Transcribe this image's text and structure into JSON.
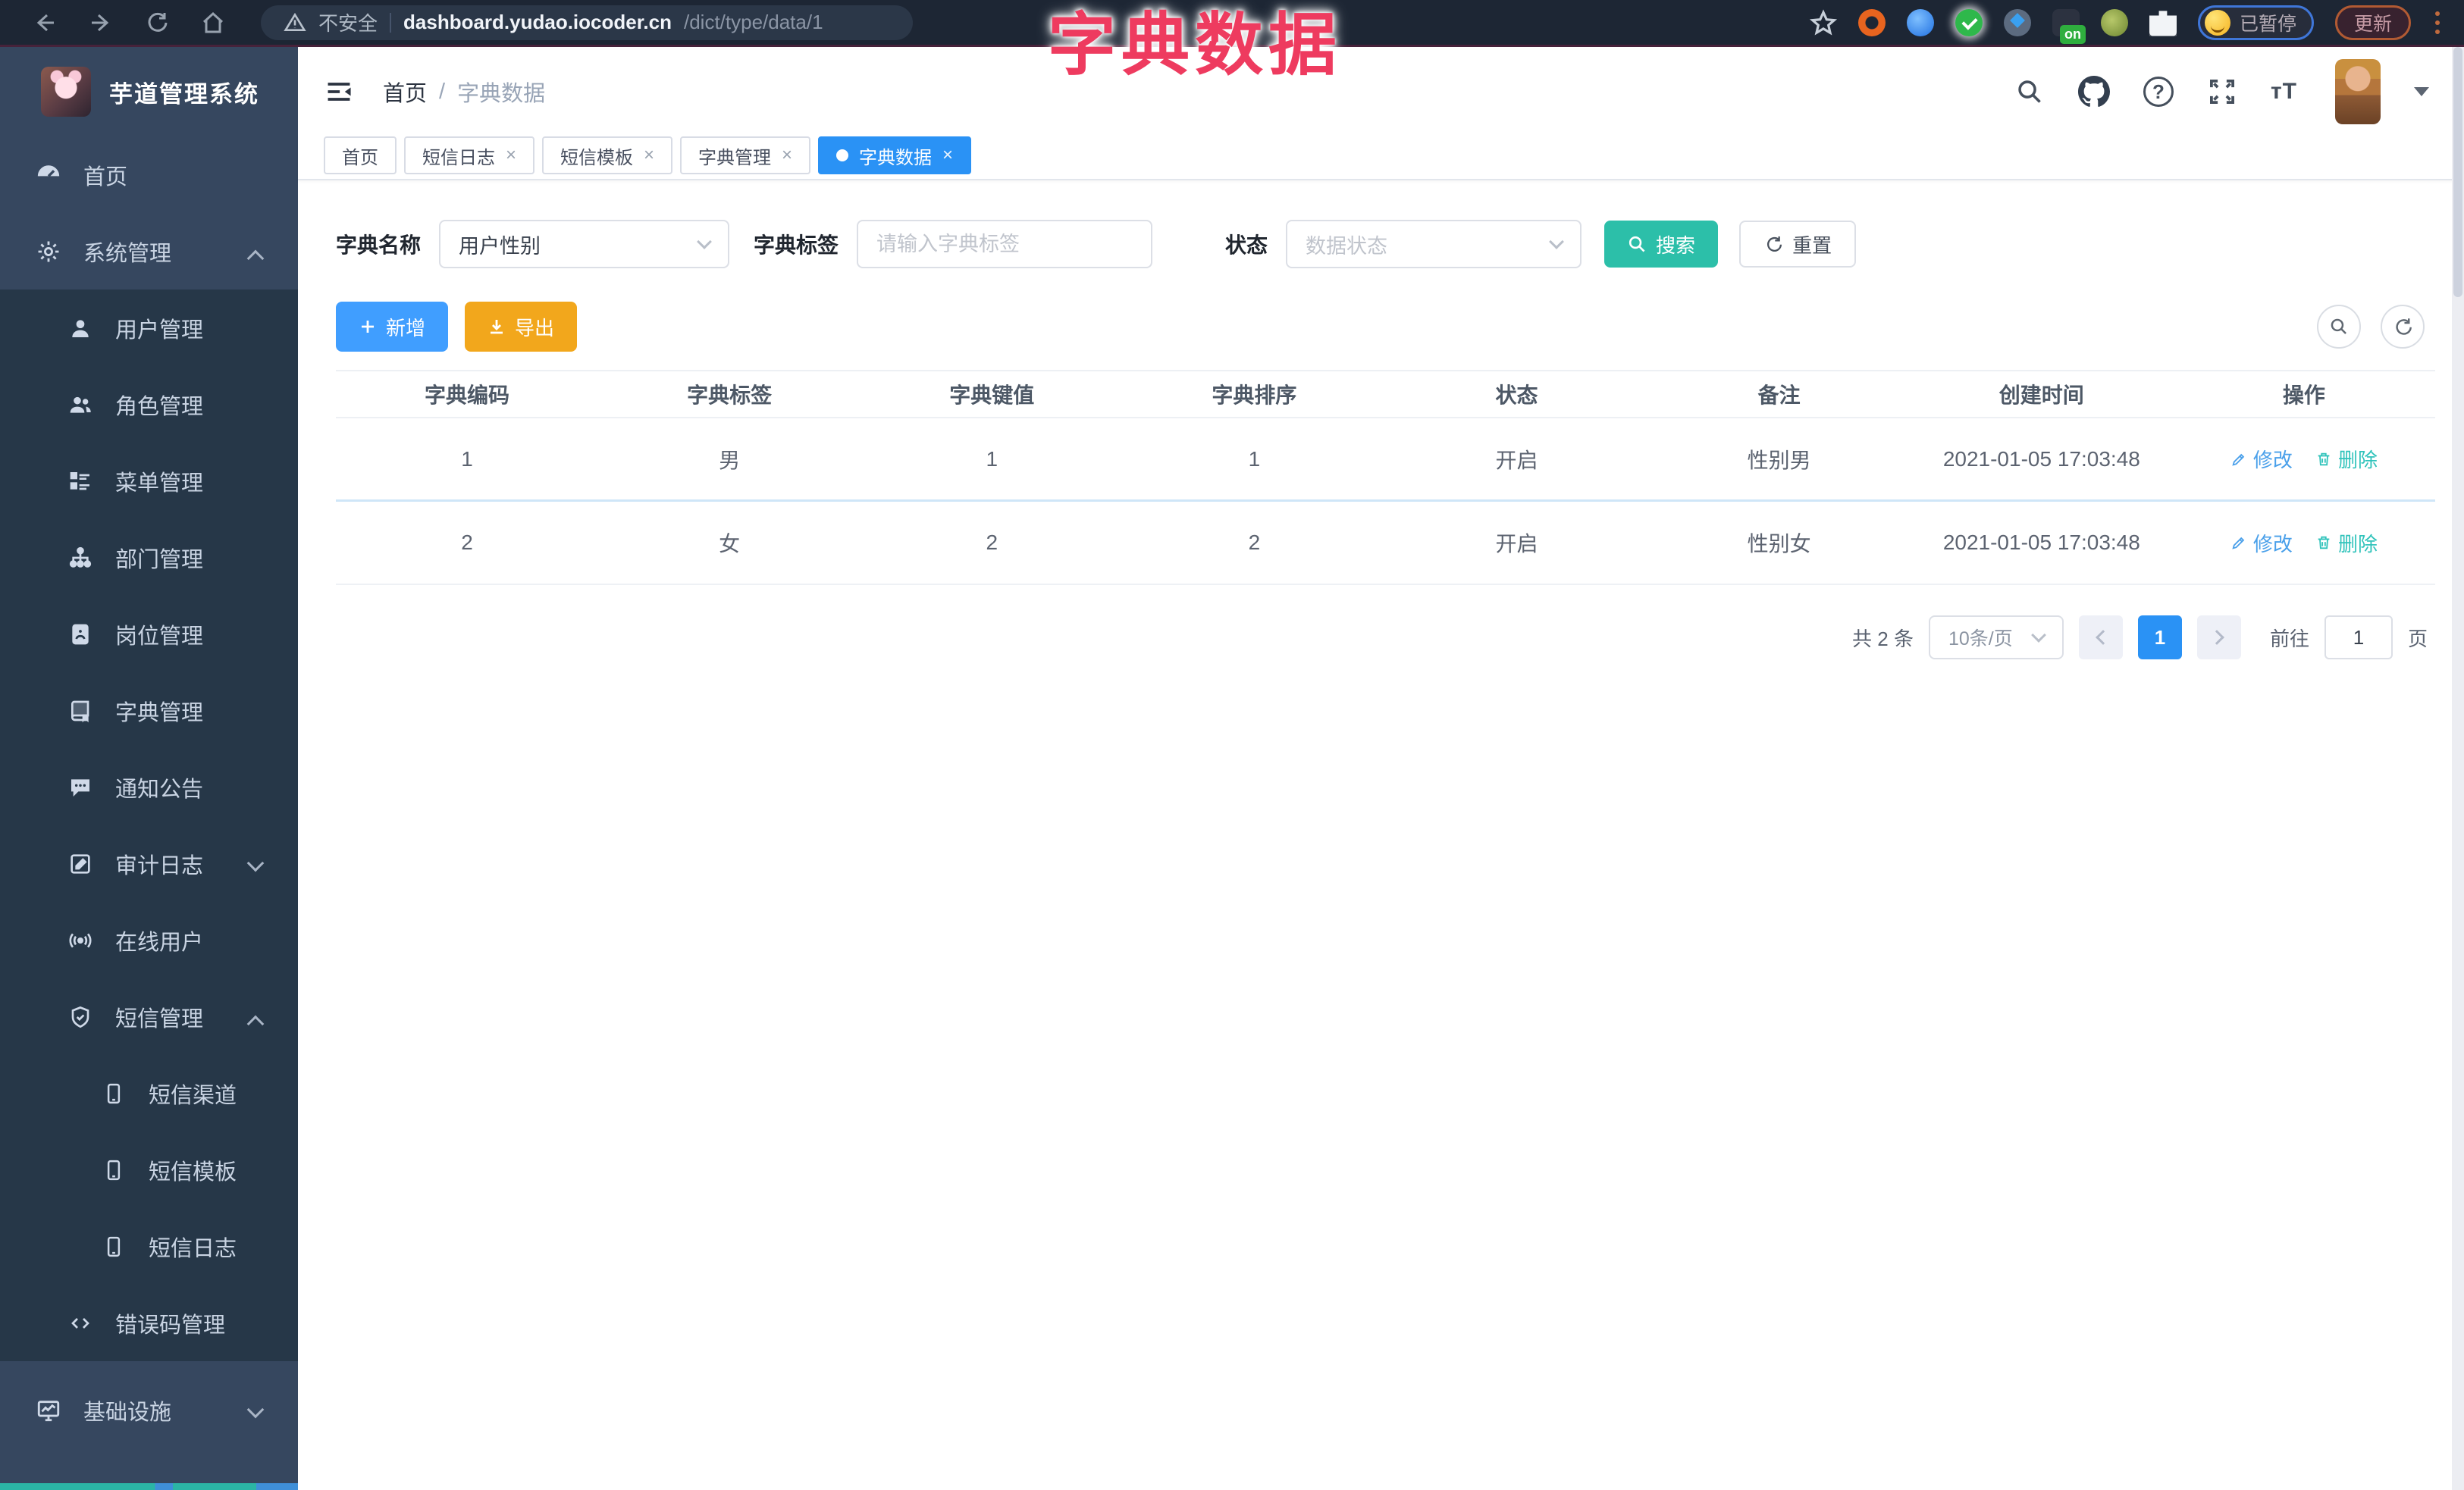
{
  "browser": {
    "security_label": "不安全",
    "url_host": "dashboard.yudao.iocoder.cn",
    "url_path": "/dict/type/data/1",
    "extension_on_badge": "on",
    "profile_badge": "已暂停",
    "update_button": "更新"
  },
  "overlay_title": "字典数据",
  "sidebar": {
    "logo_title": "芋道管理系统",
    "items": [
      {
        "label": "首页"
      },
      {
        "label": "系统管理"
      },
      {
        "label": "用户管理"
      },
      {
        "label": "角色管理"
      },
      {
        "label": "菜单管理"
      },
      {
        "label": "部门管理"
      },
      {
        "label": "岗位管理"
      },
      {
        "label": "字典管理"
      },
      {
        "label": "通知公告"
      },
      {
        "label": "审计日志"
      },
      {
        "label": "在线用户"
      },
      {
        "label": "短信管理"
      },
      {
        "label": "短信渠道"
      },
      {
        "label": "短信模板"
      },
      {
        "label": "短信日志"
      },
      {
        "label": "错误码管理"
      },
      {
        "label": "基础设施"
      }
    ]
  },
  "header": {
    "breadcrumb_home": "首页",
    "breadcrumb_sep": "/",
    "breadcrumb_current": "字典数据",
    "help_glyph": "?",
    "font_size_glyph": "тT"
  },
  "tabs": [
    {
      "label": "首页"
    },
    {
      "label": "短信日志"
    },
    {
      "label": "短信模板"
    },
    {
      "label": "字典管理"
    },
    {
      "label": "字典数据"
    }
  ],
  "icons": {
    "close": "×"
  },
  "filters": {
    "dict_name_label": "字典名称",
    "dict_name_value": "用户性别",
    "dict_label_label": "字典标签",
    "dict_label_placeholder": "请输入字典标签",
    "status_label": "状态",
    "status_placeholder": "数据状态",
    "search_button": "搜索",
    "reset_button": "重置"
  },
  "toolbar": {
    "add_button": "新增",
    "export_button": "导出"
  },
  "table": {
    "headers": [
      "字典编码",
      "字典标签",
      "字典键值",
      "字典排序",
      "状态",
      "备注",
      "创建时间",
      "操作"
    ],
    "rows": [
      {
        "code": "1",
        "label": "男",
        "value": "1",
        "sort": "1",
        "status": "开启",
        "remark": "性别男",
        "created": "2021-01-05 17:03:48"
      },
      {
        "code": "2",
        "label": "女",
        "value": "2",
        "sort": "2",
        "status": "开启",
        "remark": "性别女",
        "created": "2021-01-05 17:03:48"
      }
    ],
    "edit_label": "修改",
    "delete_label": "删除"
  },
  "pagination": {
    "total_text": "共 2 条",
    "page_size": "10条/页",
    "current_page": "1",
    "goto_label": "前往",
    "goto_value": "1",
    "page_suffix": "页"
  },
  "colors": {
    "primary_blue": "#409eff",
    "teal": "#2cbfa9",
    "orange": "#f2a71c",
    "active_tab": "#2a92f5",
    "overlay_pink": "#ee3b5f",
    "sidebar_dark": "#263748",
    "sidebar_light": "#36475f"
  }
}
